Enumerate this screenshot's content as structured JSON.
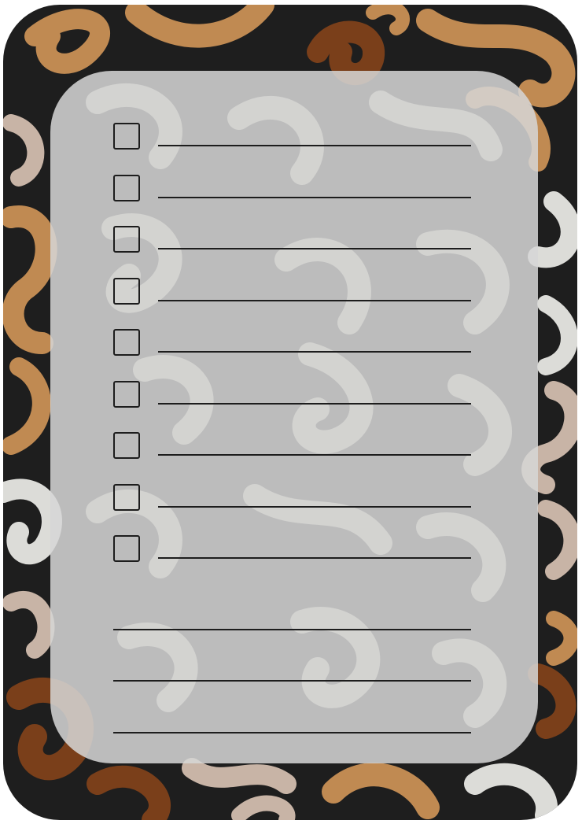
{
  "colors": {
    "background": "#1e1e1e",
    "swirl_orange": "#c08a52",
    "swirl_brown": "#7a3f1a",
    "swirl_tan": "#c8b4a6",
    "swirl_gray": "#dcdcd8",
    "panel": "#d6d6d6",
    "ink": "#1d1d1d"
  },
  "checklist": {
    "items": [
      {
        "checked": false
      },
      {
        "checked": false
      },
      {
        "checked": false
      },
      {
        "checked": false
      },
      {
        "checked": false
      },
      {
        "checked": false
      },
      {
        "checked": false
      },
      {
        "checked": false
      },
      {
        "checked": false
      }
    ]
  },
  "notes": {
    "lines": 3
  }
}
